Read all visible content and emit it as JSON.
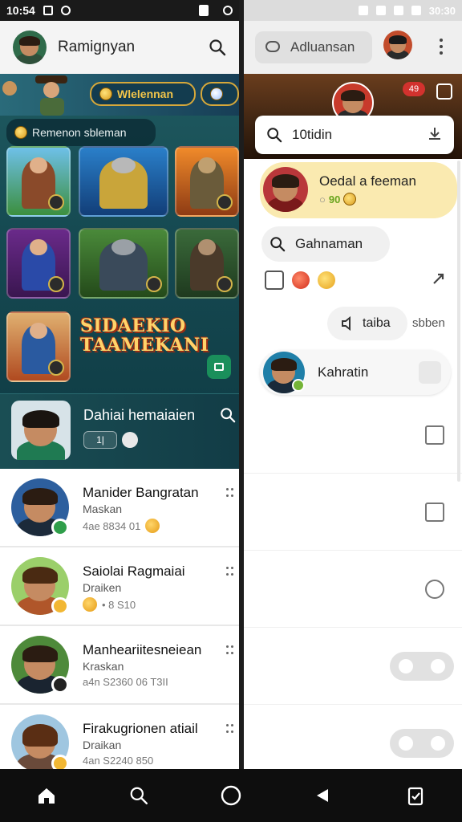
{
  "left_status": {
    "time": "10:54"
  },
  "left_header": {
    "title": "Ramignyan"
  },
  "game_panel": {
    "pill_gold_label": "Wlelennan",
    "search_chip_label": "Remenon sbleman",
    "promo_line1": "SIDAEKIO",
    "promo_line2": "TAAMEKANI",
    "feature_name": "Dahiai hemaiaien",
    "feature_box_label": "1|"
  },
  "contacts": [
    {
      "name": "Manider Bangratan",
      "sub": "Maskan",
      "meta": "4ae  8834 01",
      "status_color": "#2f9e4a"
    },
    {
      "name": "Saiolai Ragmaiai",
      "sub": "Draiken",
      "meta": "• 8 S10",
      "status_color": "#f2b733"
    },
    {
      "name": "Manheariitesneiean",
      "sub": "Kraskan",
      "meta": "a4n  S2360  06 T3II",
      "status_color": "#222222"
    },
    {
      "name": "Firakugrionen atiail",
      "sub": "Draikan",
      "meta": "4an  S2240  850",
      "status_color": "#f2b733"
    }
  ],
  "right_status": {
    "time": "30:30"
  },
  "right_header": {
    "search_label": "Adluansan"
  },
  "hero": {
    "badge": "49"
  },
  "search_card": {
    "text": "10tidin"
  },
  "highlight": {
    "title": "Oedal a feeman",
    "subtitle_prefix": "○",
    "subtitle_value": "90"
  },
  "right_search_chip": {
    "label": "Gahnaman"
  },
  "tab_chip": {
    "label": "taiba",
    "side_label": "sbben"
  },
  "person_chip": {
    "name": "Kahratin"
  },
  "colors": {
    "accent_gold": "#d6a83a",
    "highlight_bg": "#faeab0",
    "teal_bg": "#164a52",
    "online_green": "#75b437"
  },
  "icons": {
    "nav": [
      "home-icon",
      "search-icon",
      "circle-home-icon",
      "back-icon",
      "clipboard-icon"
    ]
  }
}
